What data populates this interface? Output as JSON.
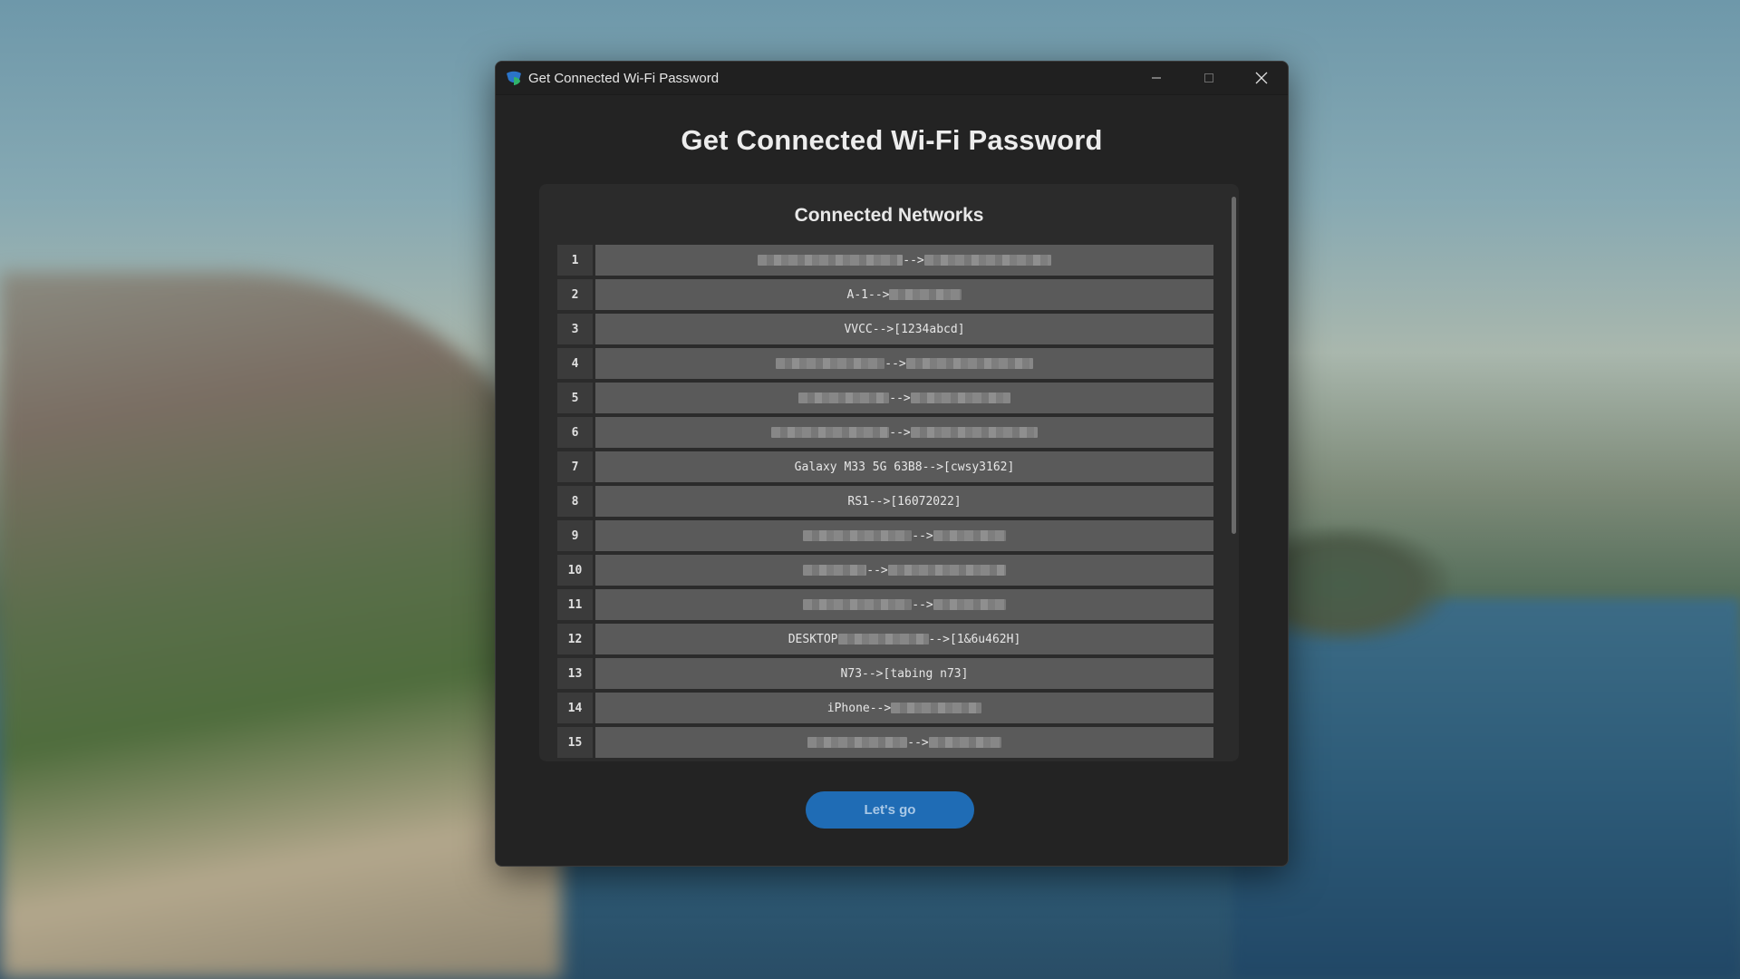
{
  "window": {
    "title": "Get Connected Wi-Fi Password",
    "app_icon": "shield-icon",
    "controls": [
      "minimize-icon",
      "maximize-icon",
      "close-icon"
    ]
  },
  "main": {
    "heading": "Get Connected Wi-Fi Password",
    "panel_title": "Connected Networks",
    "rows": [
      {
        "num": "1",
        "left": "",
        "right": ""
      },
      {
        "num": "2",
        "left": "A-1",
        "right": ""
      },
      {
        "num": "3",
        "left": "VVCC",
        "right": "[1234abcd]"
      },
      {
        "num": "4",
        "left": "",
        "right": ""
      },
      {
        "num": "5",
        "left": "",
        "right": ""
      },
      {
        "num": "6",
        "left": "",
        "right": ""
      },
      {
        "num": "7",
        "left": "Galaxy M33 5G 63B8",
        "right": "[cwsy3162]"
      },
      {
        "num": "8",
        "left": "RS1",
        "right": "[16072022]"
      },
      {
        "num": "9",
        "left": "",
        "right": ""
      },
      {
        "num": "10",
        "left": "",
        "right": ""
      },
      {
        "num": "11",
        "left": "",
        "right": ""
      },
      {
        "num": "12",
        "left": "DESKTOP",
        "right": "[1&6u462H]"
      },
      {
        "num": "13",
        "left": "N73",
        "right": "[tabing n73]"
      },
      {
        "num": "14",
        "left": "iPhone",
        "right": ""
      },
      {
        "num": "15",
        "left": "",
        "right": ""
      }
    ],
    "arrow": "-->",
    "button_label": "Let's go"
  },
  "colors": {
    "window_bg": "#232323",
    "panel_bg": "#2b2b2b",
    "row_bg": "#5a5a5a",
    "accent": "#1f6cb5"
  }
}
